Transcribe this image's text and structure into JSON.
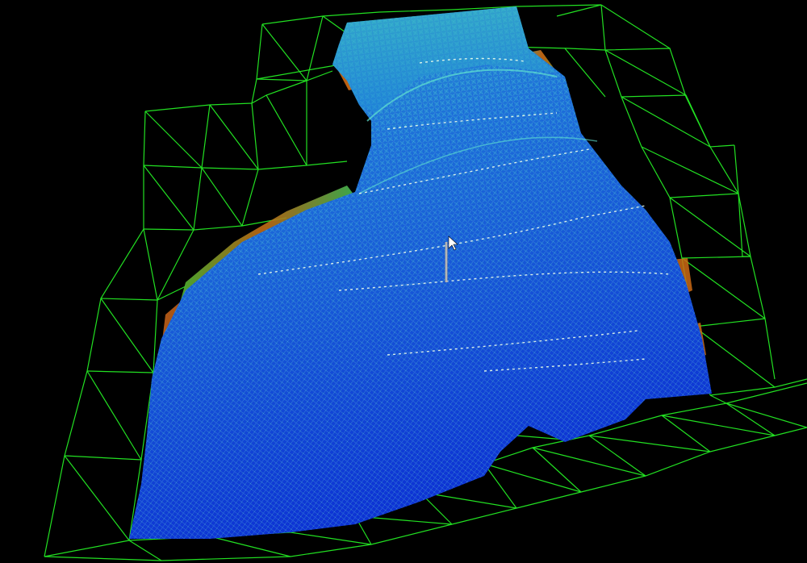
{
  "viewport": {
    "background": "#000000"
  },
  "colors": {
    "wireframe": "#22e022",
    "surface_deep": "#0a2fd0",
    "surface_mid": "#1f6fd8",
    "surface_light": "#33c0c0",
    "slope_green": "#2fbf3a",
    "slope_orange": "#d06010",
    "contour": "#e8ffe8",
    "probe": "#9a9a9a"
  },
  "icons": {
    "cursor": "arrow-cursor-icon",
    "probe": "survey-probe-icon"
  }
}
